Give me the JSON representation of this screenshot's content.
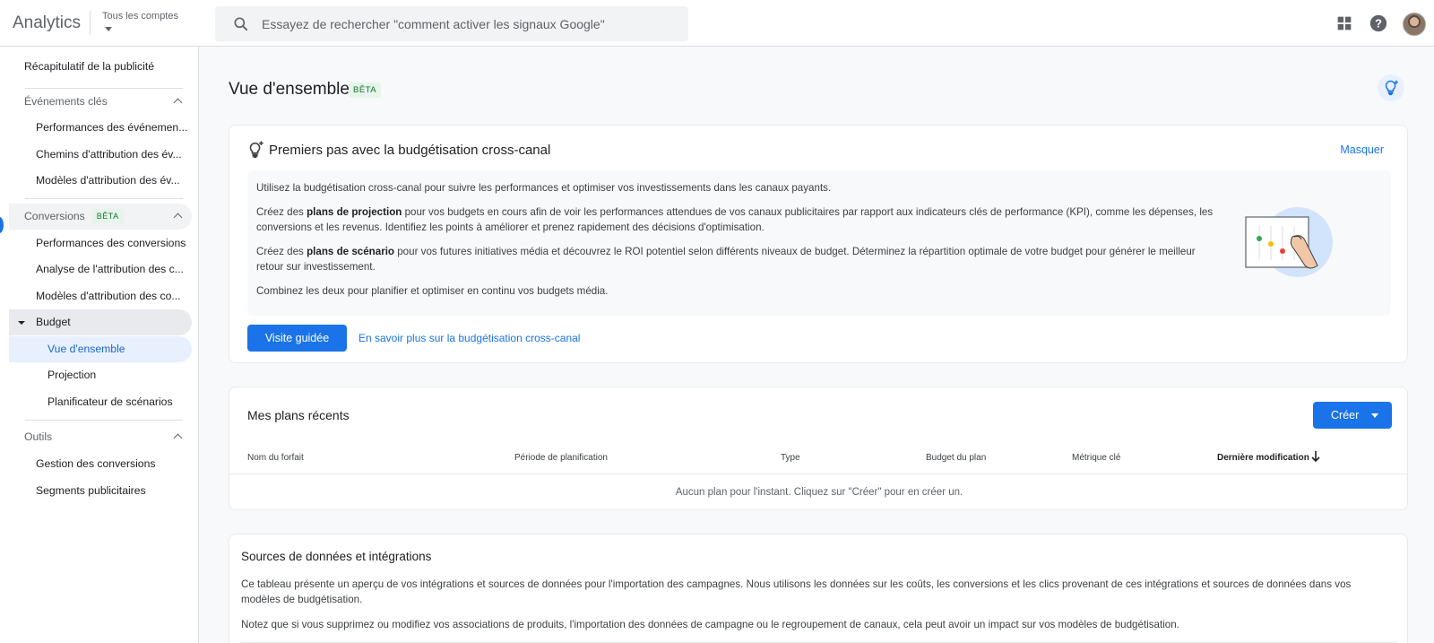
{
  "topbar": {
    "brand": "Analytics",
    "account_label": "Tous les comptes",
    "search_placeholder": "Essayez de rechercher \"comment activer les signaux Google\""
  },
  "sidebar": {
    "top_item": "Récapitulatif de la publicité",
    "sections": [
      {
        "title": "Événements clés",
        "items": [
          "Performances des événemen...",
          "Chemins d'attribution des év...",
          "Modèles d'attribution des év..."
        ]
      },
      {
        "title": "Conversions",
        "badge": "BÊTA",
        "items": [
          "Performances des conversions",
          "Analyse de l'attribution des c...",
          "Modèles d'attribution des co..."
        ]
      },
      {
        "title": "Outils",
        "items": [
          "Gestion des conversions",
          "Segments publicitaires"
        ]
      }
    ],
    "budget": {
      "label": "Budget",
      "items": [
        "Vue d'ensemble",
        "Projection",
        "Planificateur de scénarios"
      ]
    }
  },
  "main": {
    "title": "Vue d'ensemble",
    "badge": "BÊTA",
    "getting_started": {
      "title": "Premiers pas avec la budgétisation cross-canal",
      "hide": "Masquer",
      "p1": "Utilisez la budgétisation cross-canal pour suivre les performances et optimiser vos investissements dans les canaux payants.",
      "p2_pre": "Créez des ",
      "p2_bold": "plans de projection",
      "p2_post": " pour vos budgets en cours afin de voir les performances attendues de vos canaux publicitaires par rapport aux indicateurs clés de performance (KPI), comme les dépenses, les conversions et les revenus. Identifiez les points à améliorer et prenez rapidement des décisions d'optimisation.",
      "p3_pre": "Créez des ",
      "p3_bold": "plans de scénario",
      "p3_post": " pour vos futures initiatives média et découvrez le ROI potentiel selon différents niveaux de budget. Déterminez la répartition optimale de votre budget pour générer le meilleur retour sur investissement.",
      "p4": "Combinez les deux pour planifier et optimiser en continu vos budgets média.",
      "tour_button": "Visite guidée",
      "learn_more": "En savoir plus sur la budgétisation cross-canal"
    },
    "recent_plans": {
      "title": "Mes plans récents",
      "create_button": "Créer",
      "columns": [
        "Nom du forfait",
        "Période de planification",
        "Type",
        "Budget du plan",
        "Métrique clé",
        "Dernière modification"
      ],
      "empty": "Aucun plan pour l'instant. Cliquez sur \"Créer\" pour en créer un."
    },
    "sources": {
      "title": "Sources de données et intégrations",
      "p1": "Ce tableau présente un aperçu de vos intégrations et sources de données pour l'importation des campagnes. Nous utilisons les données sur les coûts, les conversions et les clics provenant de ces intégrations et sources de données dans vos modèles de budgétisation.",
      "p2": "Notez que si vous supprimez ou modifiez vos associations de produits, l'importation des données de campagne ou le regroupement de canaux, cela peut avoir un impact sur vos modèles de budgétisation."
    }
  },
  "colors": {
    "accent": "#1a73e8",
    "beta_text": "#137333",
    "beta_bg": "#e6f4ea",
    "selected_bg": "#e8f0fe"
  }
}
